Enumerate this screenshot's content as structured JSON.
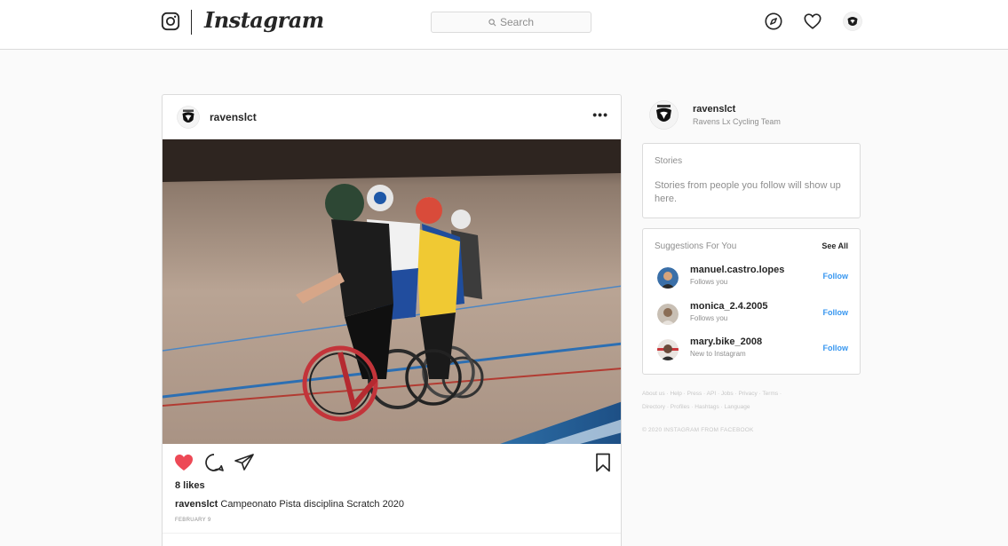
{
  "nav": {
    "brand": "Instagram",
    "search_placeholder": "Search"
  },
  "post": {
    "username": "ravenslct",
    "more": "•••",
    "likes": "8 likes",
    "caption_user": "ravenslct",
    "caption_text": " Campeonato Pista disciplina Scratch 2020",
    "date": "FEBRUARY 9",
    "liked": true
  },
  "profile": {
    "username": "ravenslct",
    "full_name": "Ravens Lx Cycling Team"
  },
  "stories": {
    "title": "Stories",
    "empty_text": "Stories from people you follow will show up here."
  },
  "suggestions": {
    "title": "Suggestions For You",
    "see_all": "See All",
    "follow_label": "Follow",
    "items": [
      {
        "username": "manuel.castro.lopes",
        "subtitle": "Follows you"
      },
      {
        "username": "monica_2.4.2005",
        "subtitle": "Follows you"
      },
      {
        "username": "mary.bike_2008",
        "subtitle": "New to Instagram"
      }
    ]
  },
  "footer": {
    "links": [
      "About us",
      "Help",
      "Press",
      "API",
      "Jobs",
      "Privacy",
      "Terms",
      "Directory",
      "Profiles",
      "Hashtags",
      "Language"
    ],
    "copyright": "© 2020 INSTAGRAM FROM FACEBOOK"
  },
  "colors": {
    "accent": "#3897f0",
    "like": "#ed4956",
    "border": "#dbdbdb",
    "background": "#fafafa"
  },
  "icons": [
    "instagram-glyph-icon",
    "search-icon",
    "explore-compass-icon",
    "heart-icon",
    "more-dots-icon",
    "like-heart-icon",
    "comment-icon",
    "share-icon",
    "bookmark-icon"
  ]
}
